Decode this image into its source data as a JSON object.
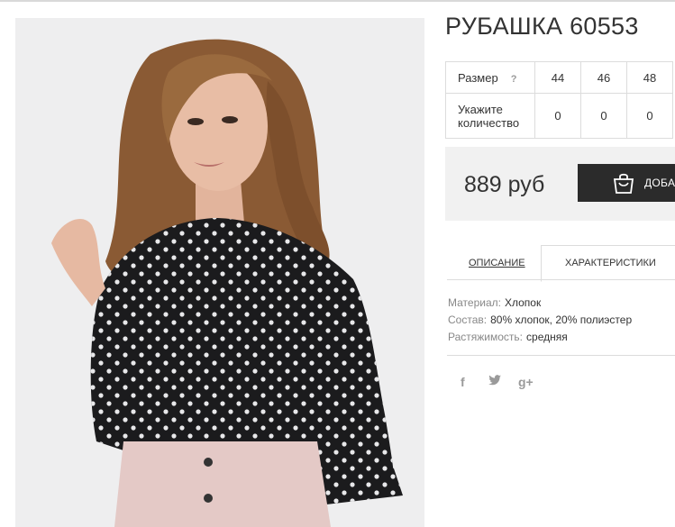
{
  "product": {
    "title": "РУБАШКА 60553",
    "image_alt": "product-photo"
  },
  "sizes": {
    "row_label": "Размер",
    "help": "?",
    "values": [
      "44",
      "46",
      "48"
    ],
    "qty_label": "Укажите количество",
    "quantities": [
      "0",
      "0",
      "0"
    ]
  },
  "purchase": {
    "price": "889 руб",
    "add_label": "ДОБАВИТЬ В КОРЗИНУ"
  },
  "tabs": [
    {
      "label": "ОПИСАНИЕ",
      "active": false
    },
    {
      "label": "ХАРАКТЕРИСТИКИ",
      "active": true
    }
  ],
  "characteristics": [
    {
      "key": "Материал:",
      "value": "Хлопок"
    },
    {
      "key": "Состав:",
      "value": "80% хлопок, 20% полиэстер"
    },
    {
      "key": "Растяжимость:",
      "value": "средняя"
    }
  ],
  "social": [
    {
      "icon": "facebook-icon",
      "glyph": "f"
    },
    {
      "icon": "twitter-icon",
      "glyph": "t"
    },
    {
      "icon": "google-plus-icon",
      "glyph": "g+"
    }
  ]
}
